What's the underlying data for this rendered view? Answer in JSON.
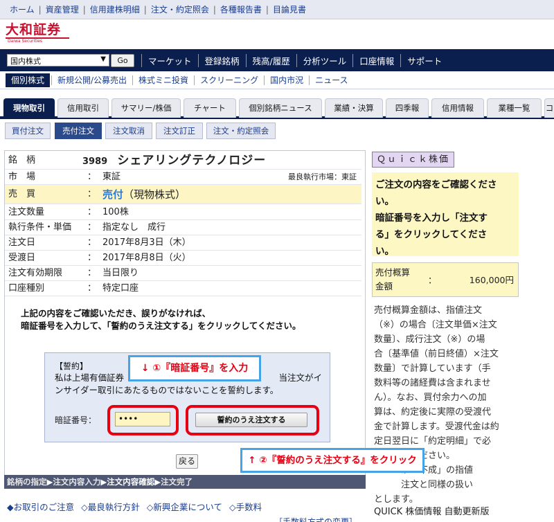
{
  "top_links": [
    "ホーム",
    "資産管理",
    "信用建株明細",
    "注文・約定照会",
    "各種報告書",
    "目論見書"
  ],
  "logo": {
    "jp": "大和証券",
    "en": "Daiwa Securities"
  },
  "product_select": {
    "value": "国内株式"
  },
  "go_label": "Go",
  "main_nav": [
    "マーケット",
    "登録銘柄",
    "残高/履歴",
    "分析ツール",
    "口座情報",
    "サポート"
  ],
  "sub_nav": {
    "active": "個別株式",
    "items": [
      "新規公開/公募売出",
      "株式ミニ投資",
      "スクリーニング",
      "国内市況",
      "ニュース"
    ]
  },
  "tabs": [
    "現物取引",
    "信用取引",
    "サマリー/株価",
    "チャート",
    "個別銘柄ニュース",
    "業績・決算",
    "四季報",
    "信用情報",
    "業種一覧",
    "コ"
  ],
  "actions": [
    "買付注文",
    "売付注文",
    "注文取消",
    "注文訂正",
    "注文・約定照会"
  ],
  "order": {
    "stock_label": "銘　柄",
    "code": "3989",
    "name": "シェアリングテクノロジー",
    "market_label": "市　場",
    "market": "東証",
    "best_market": "最良執行市場：東証",
    "trade_label": "売　買",
    "trade_kind": "売付",
    "trade_detail": "（現物株式）",
    "colon": "：",
    "rows": [
      {
        "label": "注文数量",
        "value": "100株"
      },
      {
        "label": "執行条件・単価",
        "value": "指定なし　成行"
      },
      {
        "label": "注文日",
        "value": "2017年8月3日（木）"
      },
      {
        "label": "受渡日",
        "value": "2017年8月8日（火）"
      },
      {
        "label": "注文有効期限",
        "value": "当日限り"
      },
      {
        "label": "口座種別",
        "value": "特定口座"
      }
    ]
  },
  "confirm_text": {
    "line1": "上記の内容をご確認いただき、誤りがなければ、",
    "line2": "暗証番号を入力して、「誓約のうえ注文する」をクリックしてください。"
  },
  "pledge": {
    "title": "【誓約】",
    "line1": "私は上場有価証券",
    "line1_end": "当注文がイ",
    "line2": "ンサイダー取引にあたるものではないことを誓約します。",
    "pin_label": "暗証番号：",
    "pin_value": "••••",
    "submit_label": "誓約のうえ注文する"
  },
  "notes": {
    "step1": "↓ ①『暗証番号』を入力",
    "step2": "↑ ②『誓約のうえ注文する』をクリック"
  },
  "back_label": "戻る",
  "steps": {
    "s1": "銘柄の指定",
    "s2": "注文内容入力",
    "s3": "注文内容確認",
    "s4": "注文完了",
    "arrow": "▶"
  },
  "footer_links": [
    "◆お取引のご注意",
    "◇最良執行方針",
    "◇新興企業について",
    "◇手数料"
  ],
  "fee_change": "［手数料方式の変更］",
  "quick_button": "Ｑｕｉｃｋ株価",
  "notice": {
    "line1": "ご注文の内容をご確認くださ",
    "line2": "い。",
    "line3": "暗証番号を入力し「注文す",
    "line4": "る」をクリックしてくださ",
    "line5": "い。"
  },
  "estimate": {
    "label1": "売付概算",
    "label2": "金額",
    "colon": "：",
    "value": "160,000円"
  },
  "estimate_desc": [
    "売付概算金額は、指値注文",
    "（※）の場合〔注文単価×注文",
    "数量〕、成行注文（※）の場",
    "合〔基準値（前日終値）×注文",
    "数量〕で計算しています（手",
    "数料等の諸経費は含まれませ",
    "ん）。なお、買付余力への加",
    "算は、約定後に実際の受渡代",
    "金で計算します。受渡代金は約",
    "定日翌日に「約定明細」で必",
    "ずご確認ください。",
    "　　　が「不成」の指値",
    "　　　注文と同様の扱い",
    "とします。"
  ],
  "quick_footer": "QUICK 株価情報 自動更新版",
  "colors": {
    "navy": "#0b1f4e",
    "highlight_red": "#e60012",
    "note_blue": "#46a3e6",
    "notice_yellow": "#fdf7c3"
  }
}
